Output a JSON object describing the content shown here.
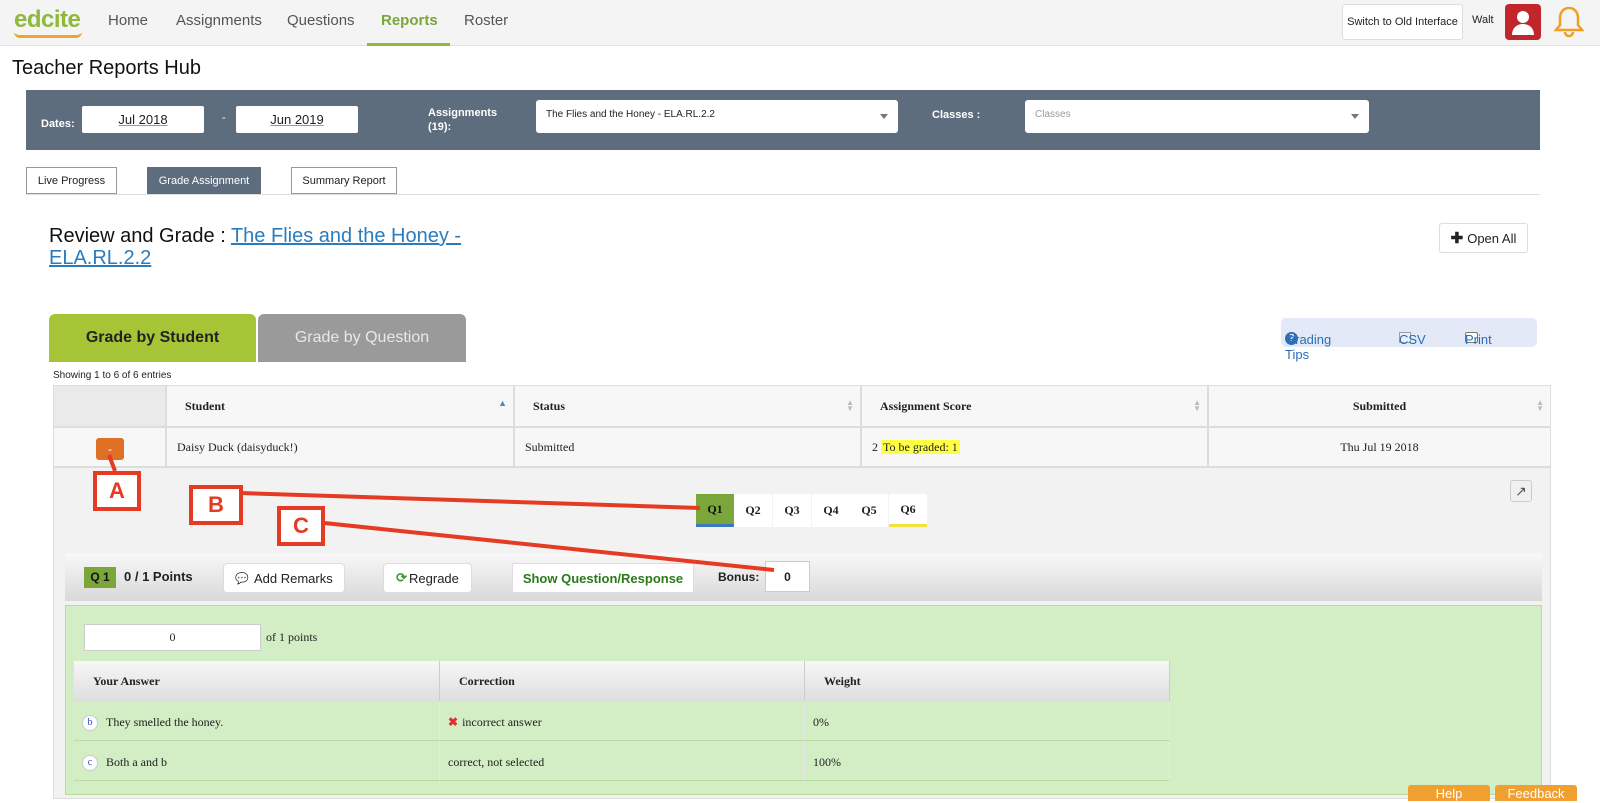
{
  "nav": {
    "logo": "edcite",
    "links": [
      "Home",
      "Assignments",
      "Questions",
      "Reports",
      "Roster"
    ],
    "active": "Reports",
    "switch_label": "Switch to Old Interface",
    "user": "Walt"
  },
  "page_title": "Teacher Reports Hub",
  "filters": {
    "dates_label": "Dates:",
    "date_from": "Jul 2018",
    "date_sep": "-",
    "date_to": "Jun 2019",
    "assignments_label": "Assignments (19):",
    "assignment_selected": "The Flies and the Honey - ELA.RL.2.2",
    "classes_label": "Classes :",
    "classes_placeholder": "Classes"
  },
  "report_tabs": [
    "Live Progress",
    "Grade Assignment",
    "Summary Report"
  ],
  "review": {
    "prefix": "Review and Grade :",
    "link": "The Flies and the Honey - ELA.RL.2.2",
    "open_all": "Open All"
  },
  "grade_tabs": {
    "student": "Grade by Student",
    "question": "Grade by Question"
  },
  "tools": {
    "grading_tips": "Grading Tips",
    "csv": "CSV",
    "print": "Print"
  },
  "showing": "Showing 1 to 6 of 6 entries",
  "table": {
    "headers": [
      "Student",
      "Status",
      "Assignment Score",
      "Submitted"
    ],
    "row": {
      "toggle": "-",
      "student": "Daisy Duck (daisyduck!)",
      "status": "Submitted",
      "score": "2",
      "to_grade": "To be graded: 1",
      "submitted": "Thu Jul 19 2018"
    }
  },
  "questions": [
    "Q1",
    "Q2",
    "Q3",
    "Q4",
    "Q5",
    "Q6"
  ],
  "qbar": {
    "badge": "Q 1",
    "points": "0 / 1 Points",
    "add_remarks": "Add Remarks",
    "regrade": "Regrade",
    "show_qr": "Show Question/Response",
    "bonus_label": "Bonus:",
    "bonus_value": "0"
  },
  "points": {
    "value": "0",
    "of": "of 1 points"
  },
  "answers": {
    "headers": [
      "Your Answer",
      "Correction",
      "Weight"
    ],
    "rows": [
      {
        "letter": "b",
        "answer": "They smelled the honey.",
        "correction": "incorrect answer",
        "weight": "0%"
      },
      {
        "letter": "c",
        "answer": "Both a and b",
        "correction": "correct, not selected",
        "weight": "100%"
      }
    ]
  },
  "footer": {
    "help": "Help",
    "feedback": "Feedback"
  },
  "annotations": [
    "A",
    "B",
    "C"
  ]
}
